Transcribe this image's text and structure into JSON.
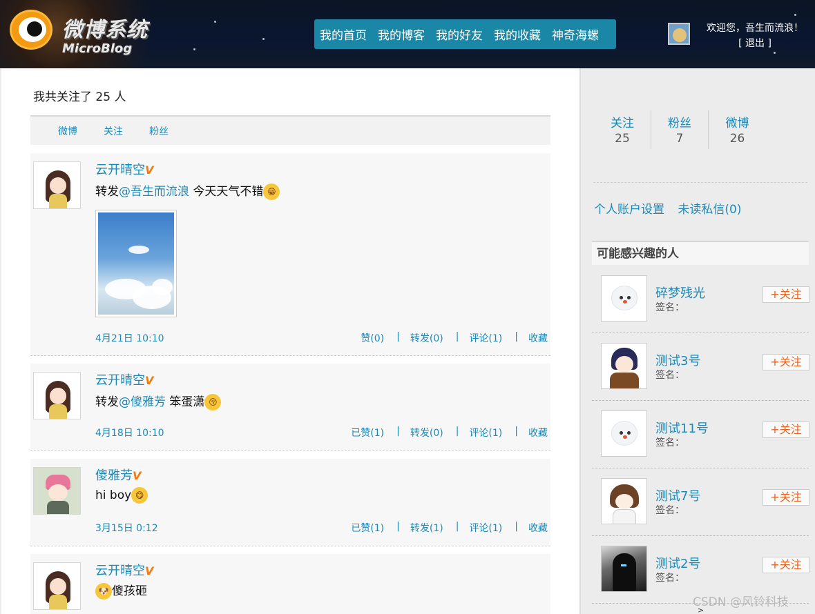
{
  "header": {
    "logo_cn": "微博系统",
    "logo_en": "MicroBlog",
    "nav": [
      "我的首页",
      "我的博客",
      "我的好友",
      "我的收藏",
      "神奇海螺"
    ],
    "welcome": "欢迎您，吾生而流浪！",
    "logout": "[ 退出 ]"
  },
  "main": {
    "follow_count": "我共关注了 25 人",
    "tabs": [
      "微博",
      "关注",
      "粉丝"
    ],
    "posts": [
      {
        "author": "云开晴空",
        "vip": "V",
        "prefix": "转发",
        "mention": "@吾生而流浪",
        "text": " 今天天气不错",
        "emoji": "😁",
        "time": "4月21日 10:10",
        "like": "赞(0)",
        "repost": "转发(0)",
        "comment": "评论(1)",
        "collect": "收藏"
      },
      {
        "author": "云开晴空",
        "vip": "V",
        "prefix": "转发",
        "mention": "@傻雅芳",
        "text": " 笨蛋潇",
        "emoji": "😚",
        "time": "4月18日 10:10",
        "like": "已赞(1)",
        "repost": "转发(0)",
        "comment": "评论(1)",
        "collect": "收藏"
      },
      {
        "author": "傻雅芳",
        "vip": "V",
        "text": "hi boy",
        "emoji": "😋",
        "time": "3月15日 0:12",
        "like": "已赞(1)",
        "repost": "转发(1)",
        "comment": "评论(1)",
        "collect": "收藏"
      },
      {
        "author": "云开晴空",
        "vip": "V",
        "emoji": "🐶",
        "text": "傻孩砸"
      }
    ],
    "separator": "|"
  },
  "sidebar": {
    "stats": [
      {
        "label": "关注",
        "value": "25"
      },
      {
        "label": "粉丝",
        "value": "7"
      },
      {
        "label": "微博",
        "value": "26"
      }
    ],
    "links": [
      "个人账户设置",
      "未读私信(0)"
    ],
    "suggest_title": "可能感兴趣的人",
    "people": [
      {
        "name": "碎梦残光",
        "sign": "签名："
      },
      {
        "name": "测试3号",
        "sign": "签名："
      },
      {
        "name": "测试11号",
        "sign": "签名："
      },
      {
        "name": "测试7号",
        "sign": "签名："
      },
      {
        "name": "测试2号",
        "sign": "签名："
      }
    ],
    "follow_label": "+关注"
  },
  "watermark": "CSDN @风铃科技",
  "more_arrow": ">"
}
